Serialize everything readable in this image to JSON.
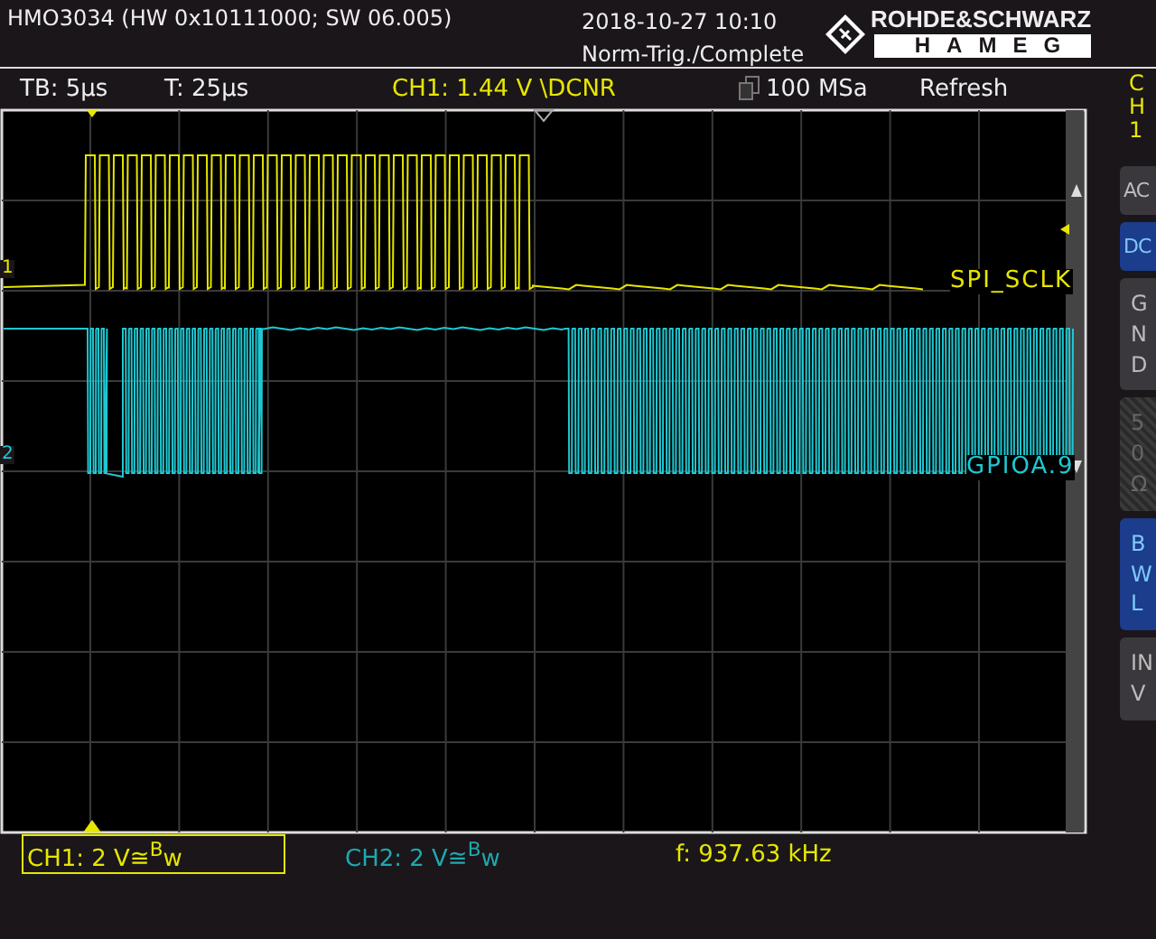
{
  "header": {
    "model": "HMO3034 (HW 0x10111000; SW 06.005)",
    "datetime": "2018-10-27 10:10",
    "trigger_status": "Norm-Trig./Complete",
    "logo": {
      "top": "ROHDE&SCHWARZ",
      "bottom": "HAMEG"
    }
  },
  "status": {
    "timebase": "TB: 5µs",
    "trigger_time": "T: 25µs",
    "trigger": "CH1: 1.44 V \\DCNR",
    "sample_rate": "100 MSa",
    "mode": "Refresh"
  },
  "traces": [
    {
      "marker": "1",
      "label": "SPI_SCLK",
      "color": "#e6e600",
      "kind": "clock"
    },
    {
      "marker": "2",
      "label": "GPIOA.9",
      "color": "#1ec8d2",
      "kind": "data"
    }
  ],
  "side_panel": {
    "channel": "CH1",
    "buttons": [
      {
        "label": "AC",
        "kind": "wide",
        "on": false,
        "disabled": false
      },
      {
        "label": "DC",
        "kind": "wide",
        "on": true,
        "disabled": false
      },
      {
        "label": "GND",
        "kind": "stacked",
        "on": false,
        "disabled": false
      },
      {
        "label": "50Ω",
        "kind": "stacked",
        "on": false,
        "disabled": true
      },
      {
        "label": "BWL",
        "kind": "stacked",
        "on": true,
        "disabled": false
      },
      {
        "label": "INV",
        "kind": "stacked",
        "on": false,
        "disabled": false
      }
    ]
  },
  "footer": {
    "channels": [
      {
        "text": "CH1: 2 V≅$^{B}$w",
        "selected": true,
        "color": "#e6e600"
      },
      {
        "text": "CH2: 2 V≅$^{B}$w",
        "selected": false,
        "color": "#1ea8b0"
      }
    ],
    "frequency": "f: 937.63 kHz"
  }
}
